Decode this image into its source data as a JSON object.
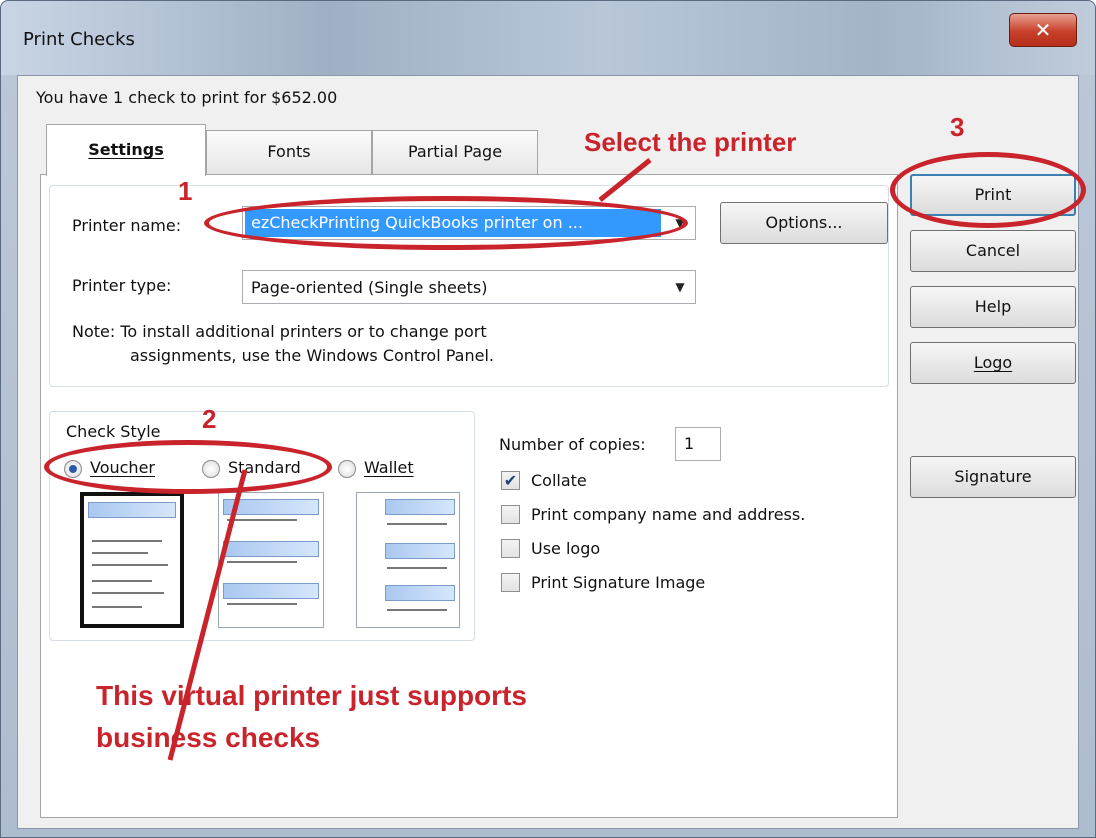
{
  "window": {
    "title": "Print Checks",
    "close_glyph": "✕"
  },
  "summary": "You have 1 check to print for $652.00",
  "tabs": [
    {
      "label": "Settings",
      "active": true
    },
    {
      "label": "Fonts",
      "active": false
    },
    {
      "label": "Partial Page",
      "active": false
    }
  ],
  "printer": {
    "name_label": "Printer name:",
    "name_value": "ezCheckPrinting QuickBooks printer on ...",
    "type_label": "Printer type:",
    "type_value": "Page-oriented (Single sheets)",
    "options_label": "Options...",
    "note_line1": "Note: To install additional printers or to change port",
    "note_line2": "assignments, use the Windows Control Panel."
  },
  "check_style": {
    "label": "Check Style",
    "options": [
      {
        "label": "Voucher",
        "selected": true
      },
      {
        "label": "Standard",
        "selected": false
      },
      {
        "label": "Wallet",
        "selected": false
      }
    ]
  },
  "copies": {
    "label": "Number of copies:",
    "value": "1"
  },
  "checkboxes": [
    {
      "label": "Collate",
      "checked": true
    },
    {
      "label": "Print company name and address.",
      "checked": false
    },
    {
      "label": "Use logo",
      "checked": false
    },
    {
      "label": "Print Signature Image",
      "checked": false
    }
  ],
  "buttons": {
    "print": "Print",
    "cancel": "Cancel",
    "help": "Help",
    "logo": "Logo",
    "signature": "Signature"
  },
  "annotations": {
    "step1": "1",
    "step2": "2",
    "step3": "3",
    "select_printer": "Select the printer",
    "note_line1": "This virtual printer just supports",
    "note_line2": "business checks",
    "color": "#c9232b"
  },
  "colors": {
    "selection_highlight": "#3399ff",
    "accent": "#3c7fb1"
  }
}
